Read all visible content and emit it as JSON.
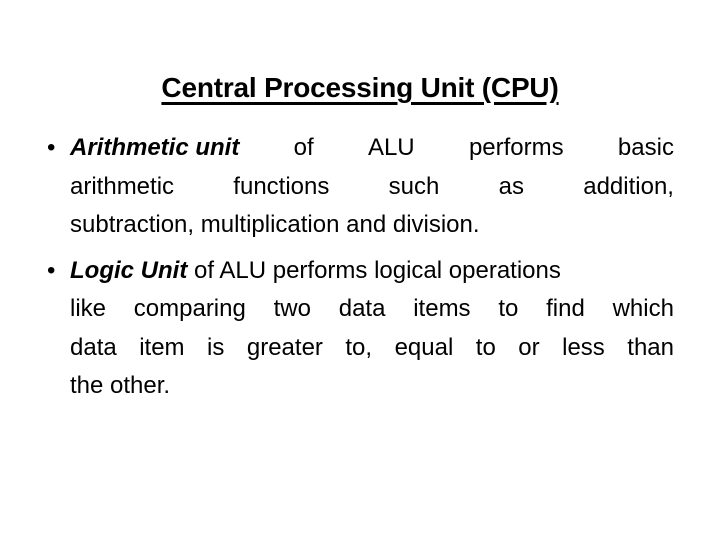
{
  "slide": {
    "background_color": "#ffffff",
    "text_color": "#000000",
    "title": "Central Processing Unit (CPU)",
    "bullets": [
      {
        "marker": "•",
        "lead": "Arithmetic unit",
        "rest": " of ALU performs basic arithmetic functions such as addition, subtraction, multiplication and division.",
        "full_text": "Arithmetic unit of ALU performs basic arithmetic functions such as addition, subtraction, multiplication and division.",
        "lines": [
          {
            "segments": [
              "of",
              "ALU",
              "performs",
              "basic"
            ],
            "justified": true
          },
          {
            "segments": [
              "arithmetic",
              "functions",
              "such",
              "as",
              "addition,"
            ],
            "justified": true
          },
          {
            "segments": [
              "subtraction, multiplication and division."
            ],
            "justified": false
          }
        ]
      },
      {
        "marker": "•",
        "lead": "Logic Unit",
        "rest": " of ALU performs logical operations like comparing two data items to find which data item is greater to, equal to or less than the other.",
        "full_text": "Logic Unit of ALU performs logical operations like comparing two data items to find which data item is greater to, equal to or less than the other.",
        "lines": [
          {
            "segments": [
              "of ALU performs logical operations"
            ],
            "justified": false
          },
          {
            "segments": [
              "like",
              "comparing",
              "two",
              "data",
              "items",
              "to",
              "find",
              "which"
            ],
            "justified": true
          },
          {
            "segments": [
              "data",
              "item",
              "is",
              "greater",
              "to,",
              "equal",
              "to",
              "or",
              "less",
              "than"
            ],
            "justified": true
          },
          {
            "segments": [
              "the other."
            ],
            "justified": false
          }
        ]
      }
    ]
  }
}
